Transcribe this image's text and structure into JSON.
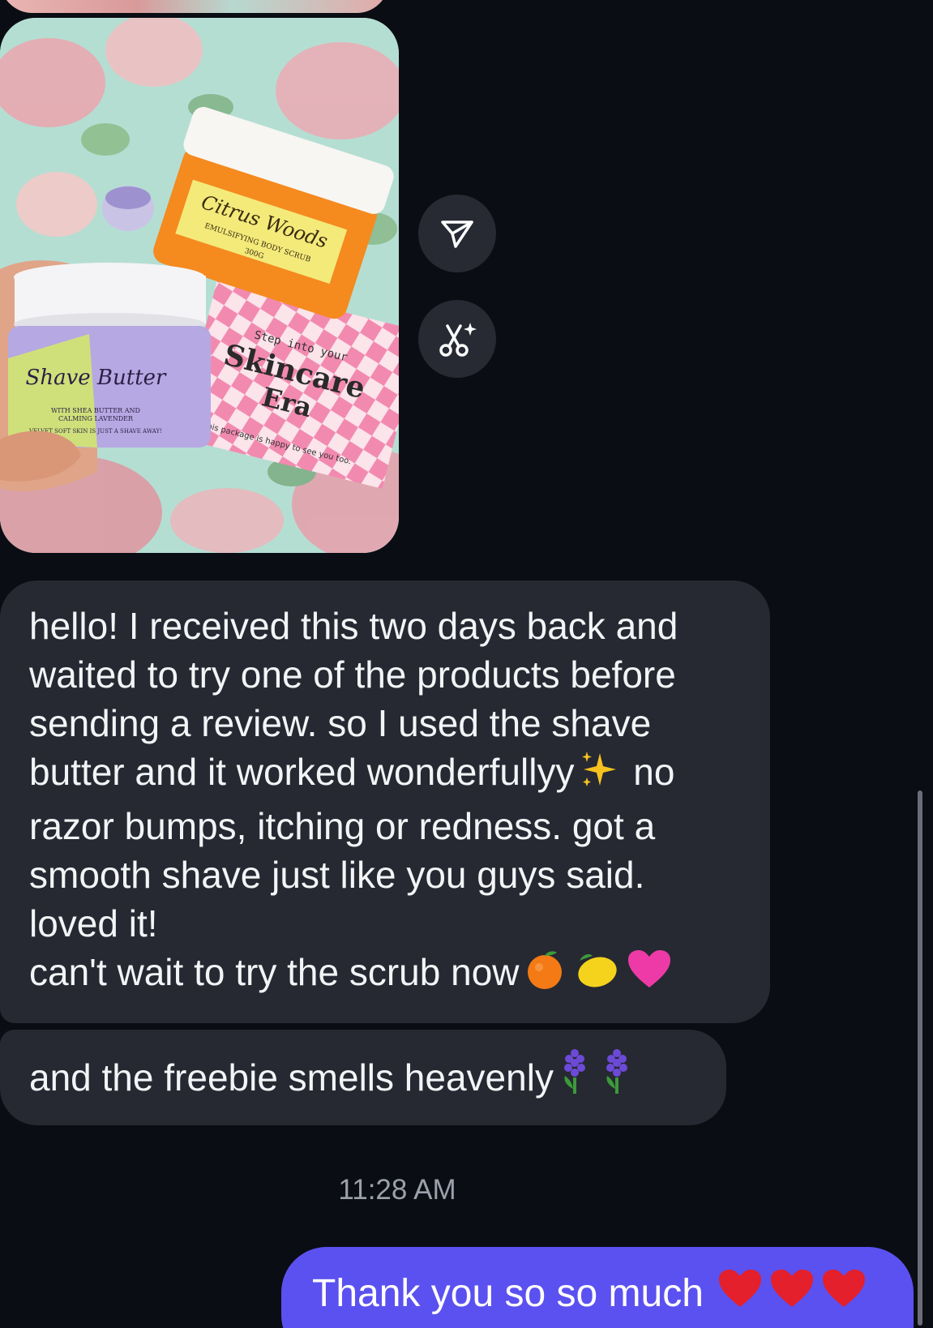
{
  "thread": {
    "photo_labels": {
      "jar_orange": "Citrus Woods",
      "jar_orange_sub": "EMULSIFYING BODY SCRUB",
      "jar_orange_weight": "300G",
      "jar_purple": "Shave Butter",
      "jar_purple_sub1": "WITH SHEA BUTTER AND",
      "jar_purple_sub2": "CALMING LAVENDER",
      "jar_purple_sub3": "VELVET SOFT SKIN IS JUST A SHAVE AWAY!",
      "card_small": "Step into your",
      "card_title1": "Skincare",
      "card_title2": "Era",
      "card_footer": "This package is happy to see you too."
    },
    "actions": {
      "share_icon": "send-icon",
      "edit_icon": "scissors-sparkle-icon"
    },
    "received_review": {
      "line1": "hello! I received this two days back and",
      "line2": "waited to try one of the products before",
      "line3": "sending a review. so I used the shave",
      "line4a": "butter and it worked wonderfullyy",
      "line4b": "no",
      "line5": "razor bumps, itching or redness. got a",
      "line6": "smooth shave just like you guys said.",
      "line7": "loved it!",
      "line8": "can't wait to try the scrub now",
      "emojis": [
        "sparkles",
        "tangerine",
        "lemon",
        "pink-heart"
      ]
    },
    "received_freebie": {
      "text": "and the freebie smells heavenly",
      "emojis": [
        "hyacinth",
        "hyacinth"
      ]
    },
    "timestamp": "11:28 AM",
    "sent_message": {
      "text": "Thank you so so much",
      "emojis": [
        "red-heart",
        "red-heart",
        "red-heart"
      ]
    },
    "colors": {
      "background": "#0b0d14",
      "received_bubble": "#262932",
      "sent_bubble": "#5b51f0",
      "action_button": "#272a33",
      "timestamp": "#9ca0ab"
    }
  }
}
